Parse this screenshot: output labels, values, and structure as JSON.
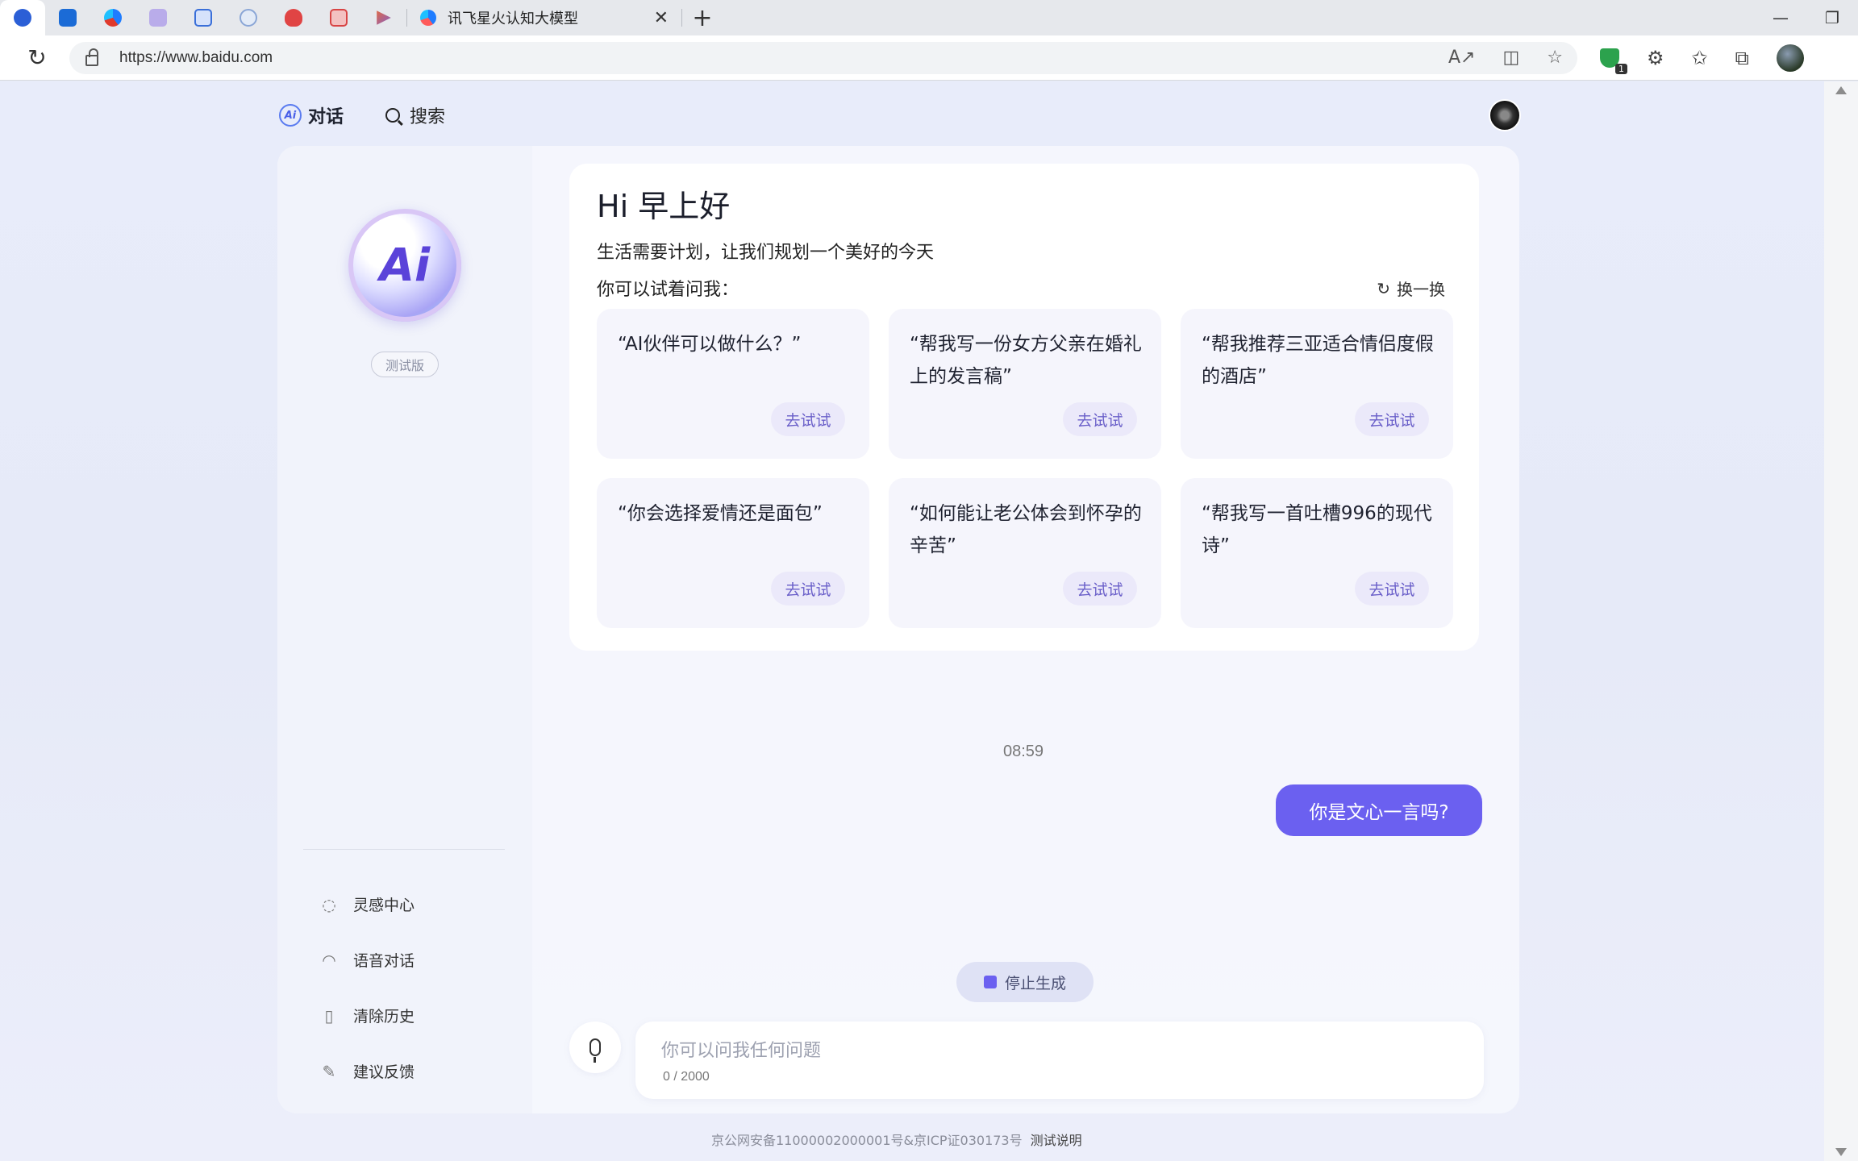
{
  "browser": {
    "tab_title": "讯飞星火认知大模型",
    "url": "https://www.baidu.com",
    "pinned_tab_colors": [
      "#2b5fd6",
      "#1b6bd6",
      "#e0392b",
      "#8f7bd8",
      "#3a6fd9",
      "#8aa6d6",
      "#e04444",
      "#d84444",
      "#e86a3a"
    ]
  },
  "nav": {
    "chat_label": "对话",
    "search_label": "搜索",
    "ai_badge": "Ai"
  },
  "sidebar": {
    "logo_text": "Ai",
    "beta": "测试版",
    "items": [
      {
        "label": "灵感中心",
        "icon": "bulb-icon"
      },
      {
        "label": "语音对话",
        "icon": "headphones-icon"
      },
      {
        "label": "清除历史",
        "icon": "trash-icon"
      },
      {
        "label": "建议反馈",
        "icon": "feedback-icon"
      }
    ]
  },
  "welcome": {
    "greeting": "Hi 早上好",
    "subtitle": "生活需要计划，让我们规划一个美好的今天",
    "try_label": "你可以试着问我：",
    "refresh_label": "换一换",
    "cards": [
      {
        "question": "“AI伙伴可以做什么？”",
        "action": "去试试"
      },
      {
        "question": "“帮我写一份女方父亲在婚礼上的发言稿”",
        "action": "去试试"
      },
      {
        "question": "“帮我推荐三亚适合情侣度假的酒店”",
        "action": "去试试"
      },
      {
        "question": "“你会选择爱情还是面包”",
        "action": "去试试"
      },
      {
        "question": "“如何能让老公体会到怀孕的辛苦”",
        "action": "去试试"
      },
      {
        "question": "“帮我写一首吐槽996的现代诗”",
        "action": "去试试"
      }
    ]
  },
  "chat": {
    "timestamp": "08:59",
    "user_message": "你是文心一言吗?",
    "stop_label": "停止生成"
  },
  "input": {
    "placeholder": "你可以问我任何问题",
    "value": "",
    "counter": "0 / 2000"
  },
  "footer": {
    "icp": "京公网安备11000002000001号&京ICP证030173号",
    "link": "测试说明"
  },
  "colors": {
    "accent": "#6b60f0",
    "bg": "#e8ecfa"
  }
}
